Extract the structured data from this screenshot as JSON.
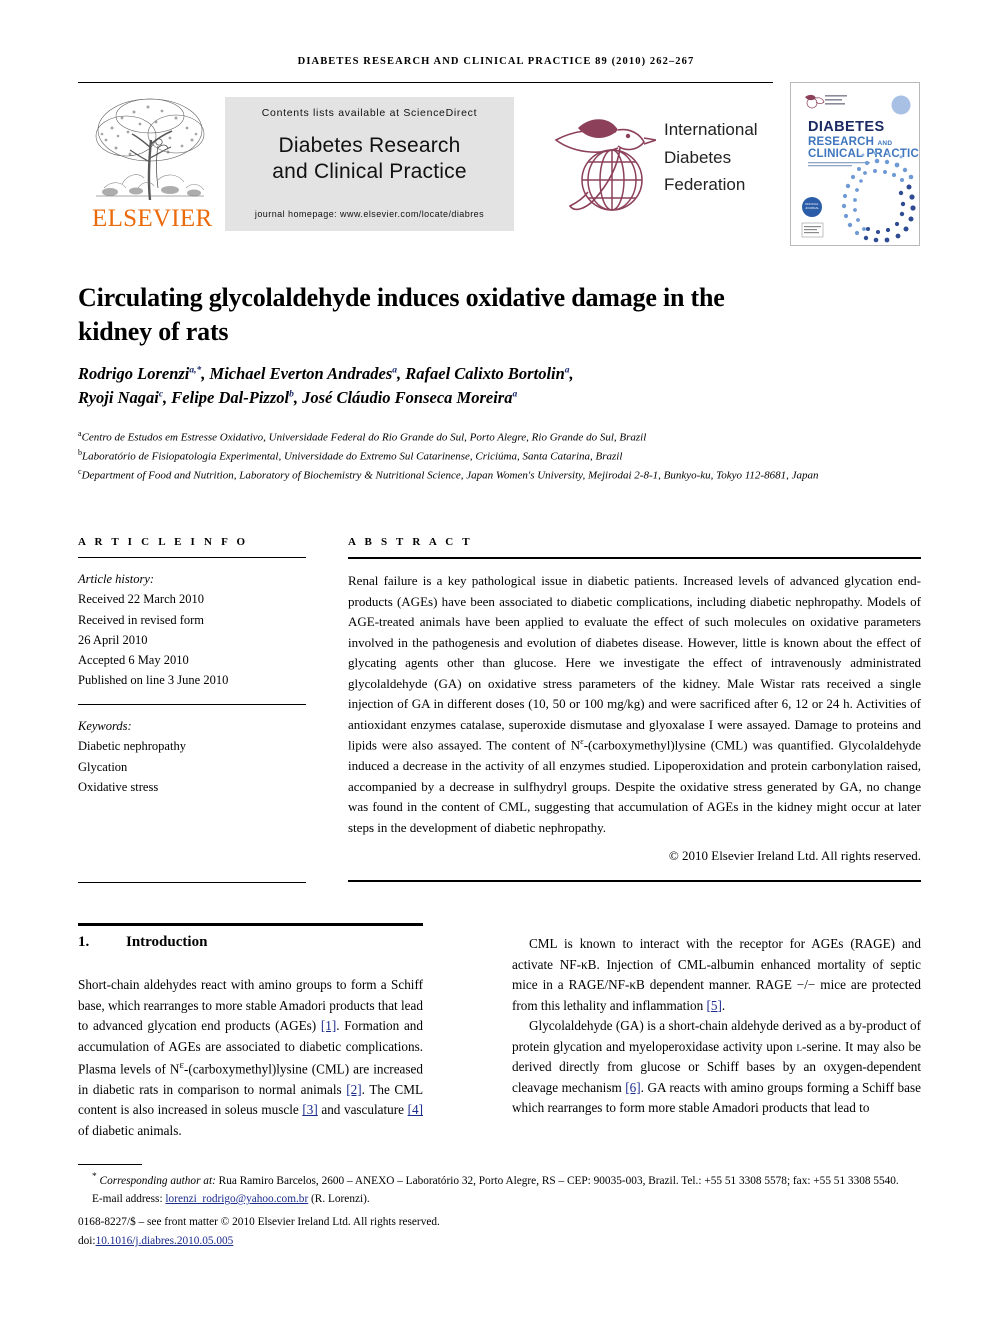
{
  "running_head": "DIABETES RESEARCH AND CLINICAL PRACTICE 89 (2010) 262–267",
  "masthead": {
    "publisher_name": "ELSEVIER",
    "contents_line": "Contents lists available at ScienceDirect",
    "journal_title_line1": "Diabetes Research",
    "journal_title_line2": "and Clinical Practice",
    "homepage": "journal homepage: www.elsevier.com/locate/diabres",
    "society": {
      "line1": "International",
      "line2": "Diabetes",
      "line3": "Federation"
    },
    "cover": {
      "org": "International Diabetes Federation",
      "title_line1": "DIABETES",
      "title_line2": "RESEARCH AND",
      "title_line3": "CLINICAL PRACTICE",
      "subtitle": "Official Journal of the International Diabetes Federation",
      "publisher": "ELSEVIER"
    }
  },
  "article": {
    "title": "Circulating glycolaldehyde induces oxidative damage in the kidney of rats",
    "authors_line1": "Rodrigo Lorenzi",
    "authors_line1_sup1": "a,*",
    "authors_line1_b": ", Michael Everton Andrades",
    "authors_line1_sup2": "a",
    "authors_line1_c": ", Rafael Calixto Bortolin",
    "authors_line1_sup3": "a",
    "authors_line1_d": ",",
    "authors_line2": "Ryoji Nagai",
    "authors_line2_sup1": "c",
    "authors_line2_b": ", Felipe Dal-Pizzol",
    "authors_line2_sup2": "b",
    "authors_line2_c": ", José Cláudio Fonseca Moreira",
    "authors_line2_sup3": "a",
    "affiliations": [
      {
        "marker": "a",
        "text": "Centro de Estudos em Estresse Oxidativo, Universidade Federal do Rio Grande do Sul, Porto Alegre, Rio Grande do Sul, Brazil"
      },
      {
        "marker": "b",
        "text": "Laboratório de Fisiopatologia Experimental, Universidade do Extremo Sul Catarinense, Criciúma, Santa Catarina, Brazil"
      },
      {
        "marker": "c",
        "text": "Department of Food and Nutrition, Laboratory of Biochemistry & Nutritional Science, Japan Women's University, Mejirodai 2-8-1, Bunkyo-ku, Tokyo 112-8681, Japan"
      }
    ]
  },
  "info": {
    "heading": "A R T I C L E   I N F O",
    "history_label": "Article history:",
    "history": [
      "Received 22 March 2010",
      "Received in revised form",
      "26 April 2010",
      "Accepted 6 May 2010",
      "Published on line 3 June 2010"
    ],
    "keywords_label": "Keywords:",
    "keywords": [
      "Diabetic nephropathy",
      "Glycation",
      "Oxidative stress"
    ]
  },
  "abstract": {
    "heading": "A B S T R A C T",
    "part1": "Renal failure is a key pathological issue in diabetic patients. Increased levels of advanced glycation end-products (AGEs) have been associated to diabetic complications, including diabetic nephropathy. Models of AGE-treated animals have been applied to evaluate the effect of such molecules on oxidative parameters involved in the pathogenesis and evolution of diabetes disease. However, little is known about the effect of glycating agents other than glucose. Here we investigate the effect of intravenously administrated glycolaldehyde (GA) on oxidative stress parameters of the kidney. Male Wistar rats received a single injection of GA in different doses (10, 50 or 100 mg/kg) and were sacrificed after 6, 12 or 24 h. Activities of antioxidant enzymes catalase, superoxide dismutase and glyoxalase I were assayed. Damage to proteins and lipids were also assayed. The content of N",
    "sup": "ε",
    "part2": "-(carboxymethyl)lysine (CML) was quantified. Glycolaldehyde induced a decrease in the activity of all enzymes studied. Lipoperoxidation and protein carbonylation raised, accompanied by a decrease in sulfhydryl groups. Despite the oxidative stress generated by GA, no change was found in the content of CML, suggesting that accumulation of AGEs in the kidney might occur at later steps in the development of diabetic nephropathy.",
    "copyright": "© 2010 Elsevier Ireland Ltd. All rights reserved."
  },
  "body": {
    "section_number": "1.",
    "section_title": "Introduction",
    "left_p1_a": "Short-chain aldehydes react with amino groups to form a Schiff base, which rearranges to more stable Amadori products that lead to advanced glycation end products (AGEs) ",
    "left_p1_ref1": "[1]",
    "left_p1_b": ". Formation and accumulation of AGEs are associated to diabetic complications. Plasma levels of N",
    "left_p1_sup": "ε",
    "left_p1_c": "-(carboxymethyl)lysine (CML) are increased in diabetic rats in comparison to normal animals ",
    "left_p1_ref2": "[2]",
    "left_p1_d": ". The CML content is also increased in soleus muscle ",
    "left_p1_ref3": "[3]",
    "left_p1_e": " and vasculature ",
    "left_p1_ref4": "[4]",
    "left_p1_f": " of diabetic animals.",
    "right_p1_a": "CML is known to interact with the receptor for AGEs (RAGE) and activate NF-κB. Injection of CML-albumin enhanced mortality of septic mice in a RAGE/NF-κB dependent manner. RAGE −/− mice are protected from this lethality and inflammation ",
    "right_p1_ref": "[5]",
    "right_p1_b": ".",
    "right_p2_a": "Glycolaldehyde (GA) is a short-chain aldehyde derived as a by-product of protein glycation and myeloperoxidase activity upon ",
    "right_p2_sc": "l",
    "right_p2_b": "-serine. It may also be derived directly from glucose or Schiff bases by an oxygen-dependent cleavage mechanism ",
    "right_p2_ref": "[6]",
    "right_p2_c": ". GA reacts with amino groups forming a Schiff base which rearranges to form more stable Amadori products that lead to"
  },
  "footnotes": {
    "corresponding_marker": "*",
    "corresponding_label": "Corresponding author at:",
    "corresponding_text": " Rua Ramiro Barcelos, 2600 – ANEXO – Laboratório 32, Porto Alegre, RS – CEP: 90035-003, Brazil. Tel.: +55 51 3308 5578; fax: +55 51 3308 5540.",
    "email_label": "E-mail address:",
    "email": "lorenzi_rodrigo@yahoo.com.br",
    "email_attrib": " (R. Lorenzi).",
    "issn_line": "0168-8227/$ – see front matter © 2010 Elsevier Ireland Ltd. All rights reserved.",
    "doi_label": "doi:",
    "doi": "10.1016/j.diabres.2010.05.005"
  },
  "colors": {
    "elsevier_orange": "#eb6a0a",
    "idf_maroon": "#8c405a",
    "link_blue": "#1a2a8c",
    "cover_navy": "#1b2a63",
    "cover_blue": "#3f76bd",
    "greybox": "#e3e3e3"
  }
}
